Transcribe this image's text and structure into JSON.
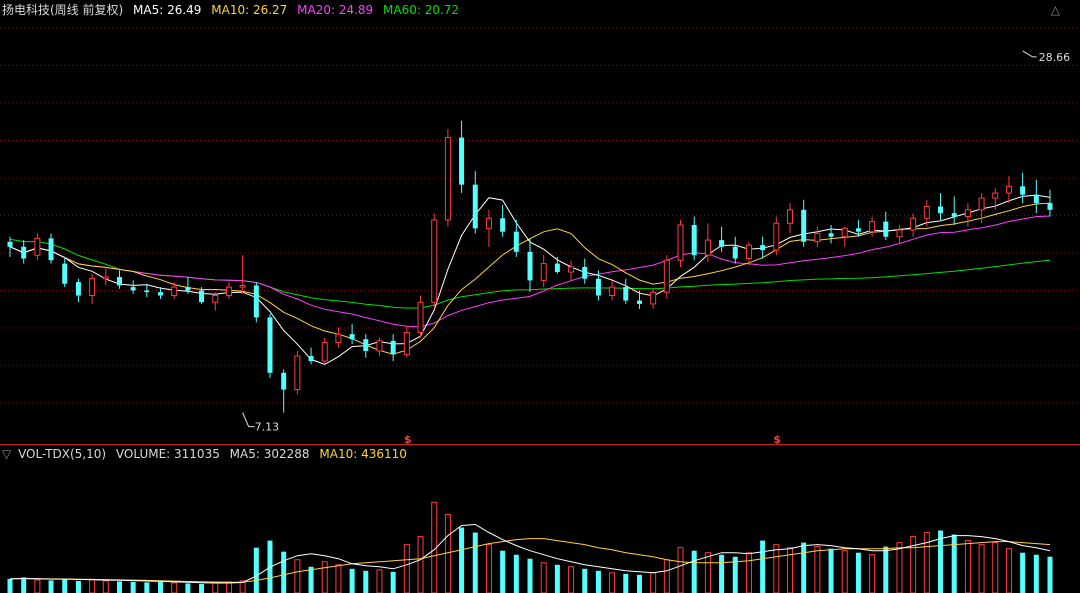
{
  "header": {
    "title": "扬电科技(周线 前复权)",
    "ma": [
      {
        "label": "MA5: 26.49",
        "color": "#ffffff"
      },
      {
        "label": "MA10: 26.27",
        "color": "#ffd23c"
      },
      {
        "label": "MA20: 24.89",
        "color": "#ff3cff"
      },
      {
        "label": "MA60: 20.72",
        "color": "#00e000"
      }
    ],
    "expand_icon": "△",
    "expand_icon_name": "triangle-up-icon"
  },
  "volume_header": {
    "collapse_icon": "▽",
    "collapse_icon_name": "triangle-down-icon",
    "title": "VOL-TDX(5,10)",
    "items": [
      {
        "label": "VOLUME: 311035",
        "color": "#d8d8d8"
      },
      {
        "label": "MA5: 302288",
        "color": "#d8d8d8"
      },
      {
        "label": "MA10: 436110",
        "color": "#ffd23c"
      }
    ]
  },
  "colors": {
    "up": "#ff3b3b",
    "down": "#54ffff",
    "grid": "#7a0f0f",
    "ma5": "#ffffff",
    "ma10": "#ffd23c",
    "ma20": "#ff3cff",
    "ma60": "#00e000",
    "divider": "#cc2222",
    "marker": "#ff3b3b"
  },
  "chart_data": {
    "type": "candlestick",
    "price_ylim": [
      5.5,
      30.5
    ],
    "grid": true,
    "annotations": [
      {
        "text": "28.66",
        "index": 74,
        "price": 28.66,
        "kind": "high"
      },
      {
        "text": "7.13",
        "index": 17,
        "price": 7.13,
        "kind": "low"
      }
    ],
    "dividend_markers": [
      {
        "text": "$",
        "index": 29
      },
      {
        "text": "$",
        "index": 56
      }
    ],
    "ohlc": [
      [
        17.3,
        17.6,
        16.4,
        17.0
      ],
      [
        17.0,
        17.4,
        16.0,
        16.3
      ],
      [
        16.5,
        17.8,
        16.2,
        17.5
      ],
      [
        17.5,
        17.8,
        16.0,
        16.2
      ],
      [
        16.0,
        16.4,
        14.6,
        14.8
      ],
      [
        14.9,
        15.1,
        13.7,
        14.1
      ],
      [
        14.1,
        15.4,
        13.6,
        15.1
      ],
      [
        15.1,
        15.8,
        14.7,
        15.2
      ],
      [
        15.2,
        15.6,
        14.5,
        14.7
      ],
      [
        14.6,
        15.0,
        14.2,
        14.4
      ],
      [
        14.4,
        14.8,
        14.0,
        14.3
      ],
      [
        14.3,
        14.6,
        13.9,
        14.1
      ],
      [
        14.1,
        14.9,
        13.9,
        14.6
      ],
      [
        14.6,
        15.2,
        14.2,
        14.4
      ],
      [
        14.4,
        14.6,
        13.6,
        13.7
      ],
      [
        13.7,
        14.3,
        13.2,
        14.1
      ],
      [
        14.1,
        14.9,
        13.9,
        14.6
      ],
      [
        14.6,
        16.5,
        14.2,
        14.7
      ],
      [
        14.7,
        14.9,
        12.5,
        12.8
      ],
      [
        12.8,
        13.0,
        9.2,
        9.5
      ],
      [
        9.5,
        9.7,
        7.13,
        8.5
      ],
      [
        8.5,
        10.8,
        8.2,
        10.5
      ],
      [
        10.5,
        11.0,
        10.0,
        10.2
      ],
      [
        10.2,
        11.6,
        10.0,
        11.3
      ],
      [
        11.3,
        12.2,
        11.0,
        11.8
      ],
      [
        11.8,
        12.4,
        11.2,
        11.5
      ],
      [
        11.5,
        11.8,
        10.4,
        10.8
      ],
      [
        10.8,
        11.6,
        10.5,
        11.4
      ],
      [
        11.4,
        11.8,
        10.2,
        10.6
      ],
      [
        10.6,
        12.3,
        10.4,
        11.9
      ],
      [
        11.9,
        14.1,
        11.6,
        13.7
      ],
      [
        13.7,
        19.0,
        13.3,
        18.6
      ],
      [
        18.6,
        24.0,
        18.2,
        23.5
      ],
      [
        23.5,
        24.5,
        20.2,
        20.7
      ],
      [
        20.7,
        21.5,
        17.8,
        18.1
      ],
      [
        18.1,
        19.2,
        17.0,
        18.7
      ],
      [
        18.7,
        19.5,
        17.6,
        17.9
      ],
      [
        17.9,
        18.6,
        16.4,
        16.7
      ],
      [
        16.7,
        17.5,
        14.3,
        15.0
      ],
      [
        15.0,
        16.5,
        14.6,
        16.0
      ],
      [
        16.0,
        16.4,
        15.4,
        15.5
      ],
      [
        15.5,
        16.2,
        15.0,
        15.8
      ],
      [
        15.8,
        16.3,
        14.8,
        15.1
      ],
      [
        15.1,
        15.6,
        13.8,
        14.1
      ],
      [
        14.1,
        15.0,
        13.8,
        14.6
      ],
      [
        14.6,
        15.1,
        13.6,
        13.8
      ],
      [
        13.8,
        14.4,
        13.3,
        13.6
      ],
      [
        13.6,
        14.5,
        13.3,
        14.3
      ],
      [
        14.3,
        16.5,
        13.9,
        16.2
      ],
      [
        16.2,
        18.6,
        15.8,
        18.3
      ],
      [
        18.3,
        18.8,
        16.2,
        16.5
      ],
      [
        16.5,
        18.4,
        16.1,
        17.4
      ],
      [
        17.4,
        18.2,
        16.7,
        17.0
      ],
      [
        17.0,
        17.6,
        16.0,
        16.3
      ],
      [
        16.3,
        17.3,
        15.9,
        17.1
      ],
      [
        17.1,
        17.6,
        16.3,
        16.8
      ],
      [
        16.8,
        18.8,
        16.5,
        18.4
      ],
      [
        18.4,
        19.6,
        17.8,
        19.2
      ],
      [
        19.2,
        19.8,
        17.0,
        17.3
      ],
      [
        17.3,
        18.2,
        17.0,
        17.8
      ],
      [
        17.8,
        18.3,
        17.2,
        17.6
      ],
      [
        17.6,
        18.2,
        17.0,
        18.1
      ],
      [
        18.1,
        18.6,
        17.6,
        17.9
      ],
      [
        17.9,
        18.8,
        17.6,
        18.5
      ],
      [
        18.5,
        19.1,
        17.4,
        17.6
      ],
      [
        17.6,
        18.3,
        17.2,
        18.0
      ],
      [
        18.0,
        19.0,
        17.6,
        18.7
      ],
      [
        18.7,
        19.8,
        18.2,
        19.4
      ],
      [
        19.4,
        20.2,
        18.6,
        19.0
      ],
      [
        19.0,
        20.0,
        18.3,
        18.8
      ],
      [
        18.8,
        19.6,
        18.2,
        19.2
      ],
      [
        19.2,
        20.2,
        18.4,
        19.9
      ],
      [
        19.9,
        20.5,
        19.2,
        20.2
      ],
      [
        20.2,
        21.2,
        19.6,
        20.6
      ],
      [
        20.6,
        21.4,
        19.6,
        20.1
      ],
      [
        20.1,
        21.0,
        19.0,
        19.6
      ],
      [
        19.6,
        20.4,
        18.8,
        19.2
      ]
    ],
    "volume_ylim": [
      0,
      130000
    ],
    "volume": [
      14000,
      15500,
      13000,
      12500,
      14000,
      12000,
      13500,
      12000,
      11500,
      11000,
      10500,
      11000,
      10000,
      9500,
      9000,
      10000,
      11000,
      12000,
      45000,
      52000,
      41000,
      33000,
      26000,
      31000,
      28000,
      24000,
      22000,
      23000,
      21000,
      48000,
      56000,
      90000,
      78000,
      65000,
      60000,
      48000,
      42000,
      38000,
      34000,
      30000,
      28000,
      26000,
      24000,
      22000,
      20000,
      19000,
      18000,
      20000,
      33000,
      45000,
      42000,
      40000,
      38000,
      36000,
      40000,
      52000,
      48000,
      45000,
      50000,
      46000,
      44000,
      42000,
      40000,
      38000,
      46000,
      50000,
      56000,
      60000,
      62000,
      58000,
      52000,
      48000,
      50000,
      44000,
      40000,
      38000,
      36000
    ],
    "volume_ma5": [
      14000,
      14500,
      14200,
      13800,
      13800,
      13500,
      13200,
      12800,
      12600,
      12300,
      11900,
      11500,
      11000,
      10600,
      10200,
      9900,
      9900,
      10400,
      16800,
      25600,
      32000,
      37000,
      39000,
      37000,
      34000,
      29000,
      27000,
      26000,
      24000,
      28000,
      33000,
      43000,
      57000,
      67000,
      68000,
      60000,
      53000,
      47000,
      42000,
      38000,
      34000,
      31000,
      28000,
      26000,
      24000,
      22000,
      21000,
      20000,
      22000,
      27000,
      32000,
      36000,
      40000,
      40000,
      39000,
      41000,
      43000,
      44000,
      47000,
      48000,
      47000,
      45000,
      44000,
      42000,
      42000,
      44000,
      47000,
      50000,
      54000,
      57000,
      57000,
      56000,
      54000,
      51000,
      47000,
      45000,
      42000
    ],
    "volume_ma10": [
      14000,
      14200,
      14100,
      14000,
      13900,
      13700,
      13500,
      13300,
      13000,
      12800,
      12500,
      12200,
      11800,
      11400,
      11100,
      10900,
      10600,
      10600,
      12500,
      15000,
      18000,
      21000,
      23000,
      25000,
      27000,
      29000,
      30000,
      31000,
      32000,
      33000,
      34000,
      37000,
      40000,
      43000,
      46000,
      49000,
      51000,
      53000,
      54000,
      54000,
      52000,
      50000,
      48000,
      45000,
      43000,
      40000,
      38000,
      36000,
      33000,
      31000,
      30000,
      30000,
      30000,
      31000,
      32000,
      34000,
      36000,
      38000,
      40000,
      42000,
      43000,
      44000,
      44000,
      44000,
      44000,
      45000,
      45000,
      46000,
      47000,
      48000,
      49000,
      50000,
      51000,
      51000,
      50000,
      49000,
      48000
    ]
  }
}
